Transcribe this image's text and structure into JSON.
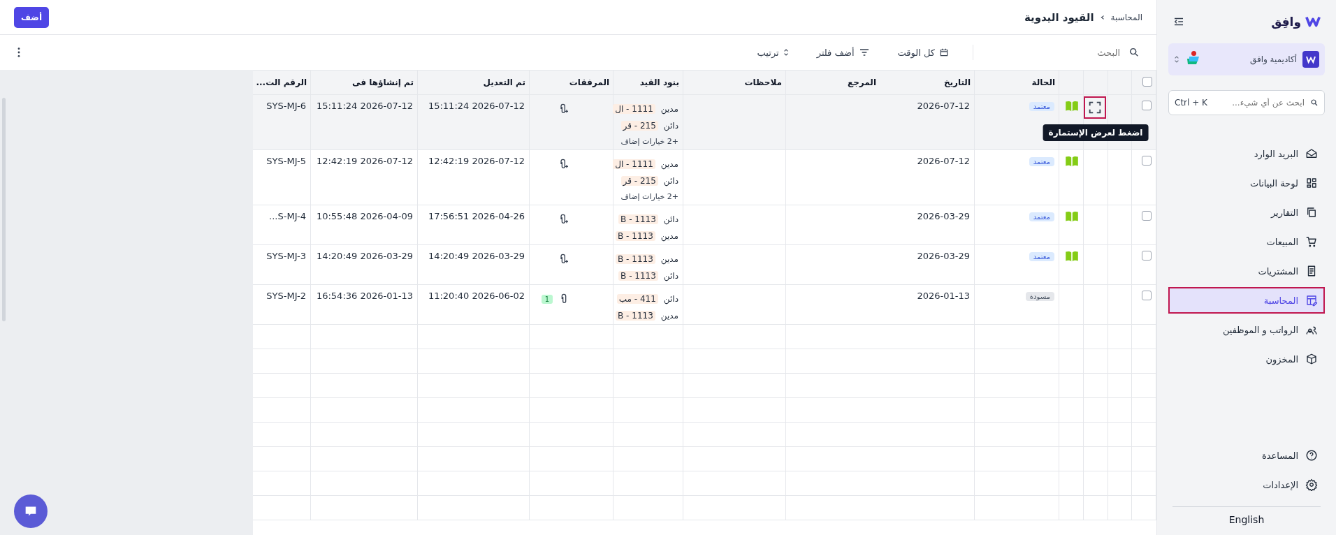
{
  "sidebar": {
    "brand": "وافِق",
    "workspace": {
      "name": "أكاديمية وافق",
      "notification": true
    },
    "search": {
      "placeholder": "ابحث عن أي شيء...",
      "shortcut": "Ctrl + K"
    },
    "items": [
      {
        "label": "البريد الوارد",
        "selected": false
      },
      {
        "label": "لوحة البيانات",
        "selected": false
      },
      {
        "label": "التقارير",
        "selected": false
      },
      {
        "label": "المبيعات",
        "selected": false
      },
      {
        "label": "المشتريات",
        "selected": false
      },
      {
        "label": "المحاسبة",
        "selected": true
      },
      {
        "label": "الرواتب و الموظفين",
        "selected": false
      },
      {
        "label": "المخزون",
        "selected": false
      }
    ],
    "footer_items": [
      {
        "label": "المساعدة"
      },
      {
        "label": "الإعدادات"
      }
    ],
    "language": "English"
  },
  "header": {
    "breadcrumb": [
      "المحاسبة",
      "القيود اليدوية"
    ],
    "add_button": "أضف"
  },
  "toolbar": {
    "search": {
      "placeholder": "البحث"
    },
    "time_filter": "كل الوقت",
    "filter_button": "أضف فلتر",
    "sort_button": "ترتيب"
  },
  "table": {
    "all_selected": false,
    "tooltip": "اضغط لعرض الإستمارة",
    "columns": [
      "الحالة",
      "التاريخ",
      "المرجع",
      "ملاحظات",
      "بنود القيد",
      "المرفقات",
      "تم التعديل",
      "تم إنشاؤها فى",
      "الرقم الت..."
    ],
    "rows": [
      {
        "selected": false,
        "hovered": true,
        "status": {
          "kind": "approved",
          "label": "معتمد"
        },
        "date": "2026-07-12",
        "lines": [
          {
            "side": "مدين",
            "account": "1111 - ال"
          },
          {
            "side": "دائن",
            "account": "215 - قر"
          }
        ],
        "more": "+2 خيارات إضاف",
        "modified": "15:11:24 2026-07-12",
        "created": "15:11:24 2026-07-12",
        "number": "SYS-MJ-6"
      },
      {
        "selected": false,
        "hovered": false,
        "status": {
          "kind": "approved",
          "label": "معتمد"
        },
        "date": "2026-07-12",
        "lines": [
          {
            "side": "مدين",
            "account": "1111 - ال"
          },
          {
            "side": "دائن",
            "account": "215 - قر"
          }
        ],
        "more": "+2 خيارات إضاف",
        "modified": "12:42:19 2026-07-12",
        "created": "12:42:19 2026-07-12",
        "number": "SYS-MJ-5"
      },
      {
        "selected": false,
        "hovered": false,
        "status": {
          "kind": "approved",
          "label": "معتمد"
        },
        "date": "2026-03-29",
        "lines": [
          {
            "side": "دائن",
            "account": "1113 - B"
          },
          {
            "side": "مدين",
            "account": "1113 - B"
          }
        ],
        "modified": "17:56:51 2026-04-26",
        "created": "10:55:48 2026-04-09",
        "number": "...S-MJ-4"
      },
      {
        "selected": false,
        "hovered": false,
        "status": {
          "kind": "approved",
          "label": "معتمد"
        },
        "date": "2026-03-29",
        "lines": [
          {
            "side": "مدين",
            "account": "1113 - B"
          },
          {
            "side": "دائن",
            "account": "1113 - B"
          }
        ],
        "modified": "14:20:49 2026-03-29",
        "created": "14:20:49 2026-03-29",
        "number": "SYS-MJ-3"
      },
      {
        "selected": false,
        "hovered": false,
        "status": {
          "kind": "draft",
          "label": "مسودة"
        },
        "date": "2026-01-13",
        "lines": [
          {
            "side": "دائن",
            "account": "411 - مب"
          },
          {
            "side": "مدين",
            "account": "1113 - B"
          }
        ],
        "attachments": "1",
        "modified": "11:20:40 2026-06-02",
        "created": "16:54:36 2026-01-13",
        "number": "SYS-MJ-2"
      }
    ]
  }
}
